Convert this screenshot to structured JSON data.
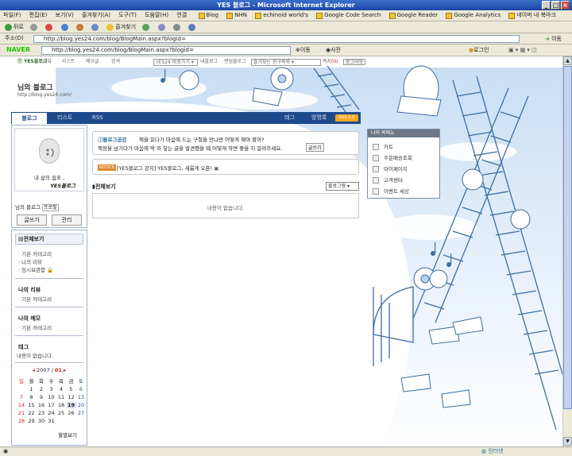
{
  "window": {
    "title": "YES 블로그 - Microsoft Internet Explorer"
  },
  "menubar": {
    "items": [
      "파일(F)",
      "편집(E)",
      "보기(V)",
      "즐겨찾기(A)",
      "도구(T)",
      "도움말(H)"
    ],
    "links_label": "연결",
    "links": [
      "Blog",
      "NHN",
      "echinoid world's",
      "Google Code Search",
      "Google Reader",
      "Google Analytics",
      "네이버 내 북마크"
    ]
  },
  "toolbar": {
    "back": "뒤로",
    "favorites": "즐겨찾기"
  },
  "addressbar": {
    "label": "주소(D)",
    "url": "http://blog.yes24.com/blog/BlogMain.aspx?blogid=",
    "go": "이동"
  },
  "naverbar": {
    "logo": "NAVER",
    "url": "http://blog.yes24.com/blog/BlogMain.aspx?blogid=",
    "go": "이동",
    "dict": "사전",
    "login": "로그인"
  },
  "topnav": {
    "items": [
      "리뷰",
      "리스트",
      "메모글",
      "검색"
    ],
    "goto": "YES24 바로가기",
    "myblog": "내블로그",
    "random": "랜덤블로그",
    "friends_select": "즐겨찾는 친구목록",
    "friends_label": "쪽지",
    "friends_count": "(0)",
    "logout": "로그아웃"
  },
  "blog": {
    "title": "님의 블로그",
    "url": "http://blog.yes24.com/"
  },
  "tabs": {
    "blog": "블로그",
    "list": "리스트",
    "rss": "RSS",
    "tag": "태그",
    "guestbook": "방명록",
    "rss_badge": "RSS 2.0"
  },
  "profile": {
    "tagline_1": "내 삶의 쉼표 ,",
    "tagline_2": "YES블로그",
    "name_prefix": "님의 블로그",
    "name_link": "프로필",
    "write": "글쓰기",
    "manage": "관리"
  },
  "sidemenu": {
    "all": "전체보기",
    "all_items": [
      "기본 카테고리",
      "나의 리뷰",
      "임시보관함"
    ],
    "review": "나의 리뷰",
    "review_items": [
      "기본 카테고리"
    ],
    "memo": "나의 메모",
    "memo_items": [
      "기본 카테고리"
    ],
    "tag": "태그",
    "tag_empty": "내용이 없습니다.",
    "more": "월별보기"
  },
  "calendar": {
    "year": "2007",
    "month": "01",
    "weekdays": [
      "일",
      "월",
      "화",
      "수",
      "목",
      "금",
      "토"
    ],
    "weeks": [
      [
        "",
        "1",
        "2",
        "3",
        "4",
        "5",
        "6"
      ],
      [
        "7",
        "8",
        "9",
        "10",
        "11",
        "12",
        "13"
      ],
      [
        "14",
        "15",
        "16",
        "17",
        "18",
        "19",
        "20"
      ],
      [
        "21",
        "22",
        "23",
        "24",
        "25",
        "26",
        "27"
      ],
      [
        "28",
        "29",
        "30",
        "31",
        "",
        "",
        ""
      ]
    ],
    "today": "19"
  },
  "notices": {
    "n1_label": "블로그공감",
    "n1_line1": "책을 읽다가 마음에 드는 구절을 만나면 어떻게 해야 할까?",
    "n1_line2": "책장을 넘기다가 마음에 딱 와 닿는 글을 발견했을 때 어떻게 하면 좋을 지 알려주세요.",
    "n1_button": "글쓰기",
    "n2_badge": "NOTICE",
    "n2_text": "[YES블로그 공지] YES블로그, 새롭게 오픈!"
  },
  "main": {
    "all_label": "전체보기",
    "select": "블로그형",
    "empty": "내용이 없습니다."
  },
  "quickmenu": {
    "title": "나의 퀵메뉴",
    "items": [
      "카트",
      "주문배송조회",
      "마이페이지",
      "고객센터",
      "이벤트 세상"
    ]
  },
  "status": {
    "zone": "인터넷"
  },
  "colors": {
    "accent": "#1e4a8c",
    "naver": "#1ec800",
    "date_red": "#d42020",
    "rss": "#f6a623"
  }
}
